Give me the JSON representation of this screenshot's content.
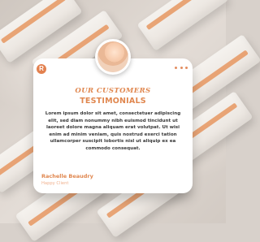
{
  "card": {
    "brand_letter": "R",
    "title_line1": "OUR CUSTOMERS",
    "title_line2": "TESTIMONIALS",
    "body": "Lorem ipsum dolor sit amet, consectetuer adipiscing elit, sed diam nonummy nibh euismod tincidunt ut laoreet dolore magna aliquam erat volutpat. Ut wisi enim ad minim veniam, quis nostrud exerci tation ullamcorper suscipit lobortis nisl ut aliquip ex ea commodo consequat.",
    "author_name": "Rachelle Beaudry",
    "author_role": "Happy Client"
  },
  "icons": {
    "brand": "brand-logo-icon",
    "more": "more-options-icon",
    "avatar": "client-avatar-photo"
  },
  "colors": {
    "accent": "#e0874f",
    "accent_light": "#f0b08d",
    "card_bg": "#ffffff",
    "text": "#3a3a3a"
  }
}
